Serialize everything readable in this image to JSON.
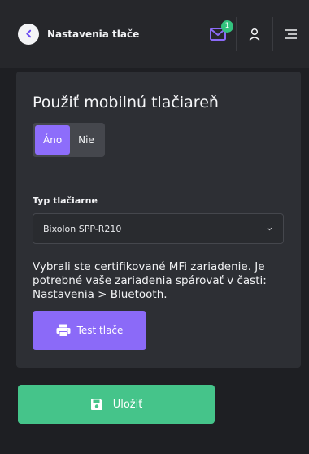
{
  "header": {
    "title": "Nastavenia tlače",
    "back_icon": "chevron-left-icon",
    "mail_icon": "envelope-icon",
    "mail_badge": "1",
    "user_icon": "user-icon",
    "menu_icon": "menu-icon"
  },
  "card": {
    "title": "Použiť mobilnú tlačiareň",
    "toggle": {
      "yes": "Áno",
      "no": "Nie",
      "selected": "Áno"
    },
    "printer_type_label": "Typ tlačiarne",
    "printer_type_value": "Bixolon SPP-R210",
    "info_text": "Vybrali ste certifikované MFi zariadenie. Je potrebné vaše zariadenia spárovať v časti: Nastavenia > Bluetooth.",
    "test_button": "Test tlače",
    "test_icon": "printer-icon"
  },
  "footer": {
    "save_button": "Uložiť",
    "save_icon": "floppy-disk-icon"
  },
  "colors": {
    "accent": "#8b6af8",
    "success": "#45c48a",
    "badge": "#33c27e"
  }
}
